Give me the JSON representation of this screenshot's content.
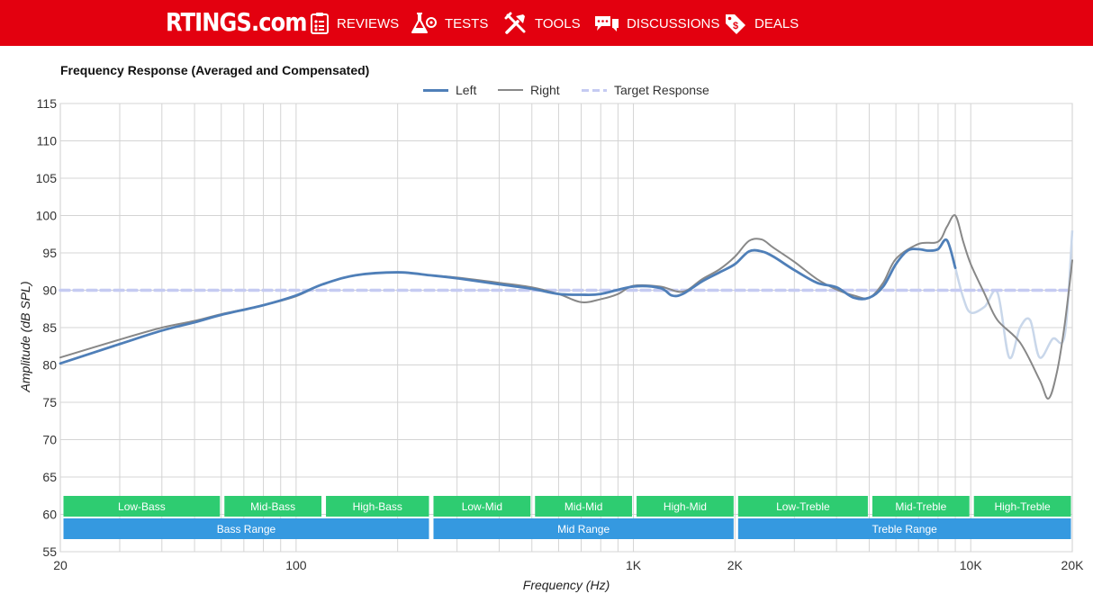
{
  "header": {
    "logo": "RTINGS.com",
    "nav": [
      {
        "label": "REVIEWS",
        "icon": "clipboard-icon"
      },
      {
        "label": "TESTS",
        "icon": "flask-icon"
      },
      {
        "label": "TOOLS",
        "icon": "tools-icon"
      },
      {
        "label": "DISCUSSIONS",
        "icon": "chat-icon"
      },
      {
        "label": "DEALS",
        "icon": "tag-icon"
      }
    ]
  },
  "chart_data": {
    "type": "line",
    "title": "Frequency Response (Averaged and Compensated)",
    "xlabel": "Frequency (Hz)",
    "ylabel": "Amplitude (dB SPL)",
    "x_scale": "log",
    "xlim": [
      20,
      20000
    ],
    "ylim": [
      55,
      115
    ],
    "grid": true,
    "legend_position": "top-center",
    "x_ticks": [
      20,
      100,
      1000,
      2000,
      10000,
      20000
    ],
    "x_tick_labels": [
      "20",
      "100",
      "1K",
      "2K",
      "10K",
      "20K"
    ],
    "y_ticks": [
      55,
      60,
      65,
      70,
      75,
      80,
      85,
      90,
      95,
      100,
      105,
      110,
      115
    ],
    "series": [
      {
        "name": "Left",
        "color": "#4f7fb8",
        "points": [
          [
            20,
            80.2
          ],
          [
            30,
            82.8
          ],
          [
            40,
            84.6
          ],
          [
            50,
            85.7
          ],
          [
            60,
            86.7
          ],
          [
            80,
            88
          ],
          [
            100,
            89.3
          ],
          [
            120,
            90.8
          ],
          [
            150,
            92
          ],
          [
            200,
            92.4
          ],
          [
            250,
            92
          ],
          [
            300,
            91.6
          ],
          [
            400,
            90.8
          ],
          [
            500,
            90.2
          ],
          [
            600,
            89.5
          ],
          [
            700,
            89.4
          ],
          [
            800,
            89.5
          ],
          [
            1000,
            90.5
          ],
          [
            1200,
            90.3
          ],
          [
            1300,
            89.3
          ],
          [
            1400,
            89.5
          ],
          [
            1600,
            91.2
          ],
          [
            1800,
            92.4
          ],
          [
            2000,
            93.5
          ],
          [
            2200,
            95.2
          ],
          [
            2400,
            95.2
          ],
          [
            2600,
            94.5
          ],
          [
            3000,
            92.7
          ],
          [
            3500,
            91
          ],
          [
            4000,
            90.4
          ],
          [
            4500,
            89
          ],
          [
            5000,
            89
          ],
          [
            5500,
            90.5
          ],
          [
            6000,
            93.5
          ],
          [
            6500,
            95.3
          ],
          [
            7000,
            95.5
          ],
          [
            7500,
            95.3
          ],
          [
            8000,
            95.5
          ],
          [
            8500,
            96.7
          ],
          [
            9000,
            93
          ]
        ]
      },
      {
        "name": "Right",
        "color": "#888888",
        "points": [
          [
            20,
            81
          ],
          [
            30,
            83.4
          ],
          [
            40,
            85
          ],
          [
            50,
            85.9
          ],
          [
            60,
            86.8
          ],
          [
            80,
            88
          ],
          [
            100,
            89.2
          ],
          [
            120,
            90.8
          ],
          [
            150,
            92
          ],
          [
            200,
            92.4
          ],
          [
            250,
            92
          ],
          [
            300,
            91.7
          ],
          [
            400,
            91
          ],
          [
            500,
            90.4
          ],
          [
            600,
            89.5
          ],
          [
            700,
            88.4
          ],
          [
            800,
            88.8
          ],
          [
            900,
            89.5
          ],
          [
            1000,
            90.6
          ],
          [
            1200,
            90.5
          ],
          [
            1400,
            89.8
          ],
          [
            1600,
            91.5
          ],
          [
            1800,
            92.8
          ],
          [
            2000,
            94.5
          ],
          [
            2200,
            96.6
          ],
          [
            2400,
            96.8
          ],
          [
            2600,
            95.7
          ],
          [
            3000,
            93.8
          ],
          [
            3500,
            91.5
          ],
          [
            4000,
            90.1
          ],
          [
            4500,
            89.3
          ],
          [
            5000,
            89
          ],
          [
            5500,
            91
          ],
          [
            6000,
            94.2
          ],
          [
            7000,
            96.2
          ],
          [
            8000,
            96.5
          ],
          [
            8500,
            98.5
          ],
          [
            9000,
            100
          ],
          [
            9500,
            96.5
          ],
          [
            10000,
            93.5
          ],
          [
            11000,
            89.5
          ],
          [
            12000,
            86
          ],
          [
            14000,
            83
          ],
          [
            16000,
            78
          ],
          [
            17000,
            75.5
          ],
          [
            18000,
            79
          ],
          [
            19000,
            85.5
          ],
          [
            20000,
            94
          ]
        ]
      },
      {
        "name": "Target Response",
        "color": "#c5cbf2",
        "dashed": true,
        "points": [
          [
            20,
            90
          ],
          [
            20000,
            90
          ]
        ]
      }
    ],
    "faded_series": [
      {
        "name": "Left",
        "points": [
          [
            9000,
            93
          ],
          [
            9500,
            89
          ],
          [
            10000,
            87
          ],
          [
            11000,
            87.8
          ],
          [
            12000,
            89.7
          ],
          [
            13000,
            81
          ],
          [
            14000,
            85
          ],
          [
            15000,
            86
          ],
          [
            16000,
            81
          ],
          [
            17500,
            83.5
          ],
          [
            19000,
            84
          ],
          [
            20000,
            98
          ]
        ]
      }
    ],
    "bands": {
      "upper": [
        {
          "label": "Low-Bass",
          "from": 20,
          "to": 60
        },
        {
          "label": "Mid-Bass",
          "from": 60,
          "to": 120
        },
        {
          "label": "High-Bass",
          "from": 120,
          "to": 250
        },
        {
          "label": "Low-Mid",
          "from": 250,
          "to": 500
        },
        {
          "label": "Mid-Mid",
          "from": 500,
          "to": 1000
        },
        {
          "label": "High-Mid",
          "from": 1000,
          "to": 2000
        },
        {
          "label": "Low-Treble",
          "from": 2000,
          "to": 5000
        },
        {
          "label": "Mid-Treble",
          "from": 5000,
          "to": 10000
        },
        {
          "label": "High-Treble",
          "from": 10000,
          "to": 20000
        }
      ],
      "lower": [
        {
          "label": "Bass Range",
          "from": 20,
          "to": 250
        },
        {
          "label": "Mid Range",
          "from": 250,
          "to": 2000
        },
        {
          "label": "Treble Range",
          "from": 2000,
          "to": 20000
        }
      ],
      "upper_color": "#2ecc71",
      "lower_color": "#3599e0"
    }
  }
}
